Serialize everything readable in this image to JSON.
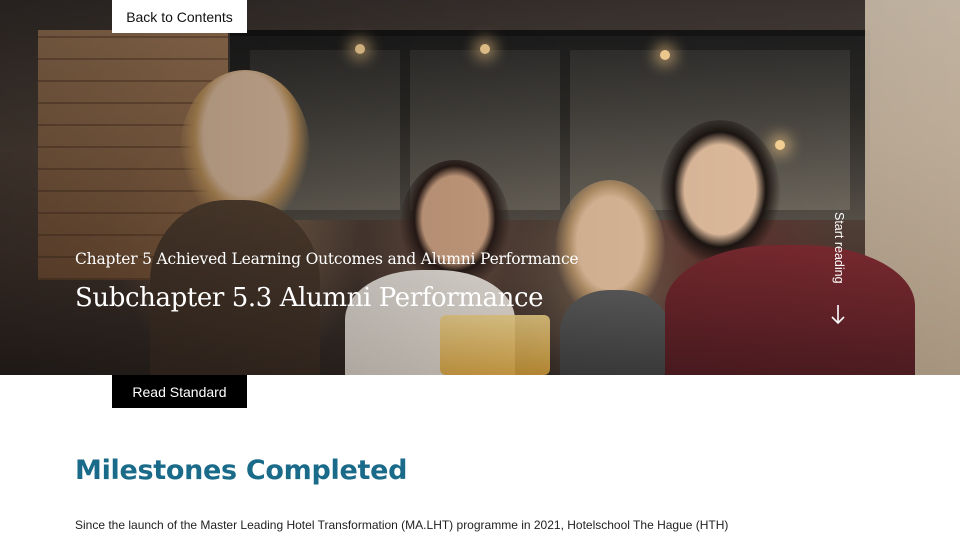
{
  "nav": {
    "back_label": "Back to Contents"
  },
  "hero": {
    "chapter": "Chapter 5 Achieved Learning Outcomes and Alumni Performance",
    "subchapter": "Subchapter 5.3 Alumni Performance",
    "start_reading": "Start reading",
    "image_alt": "Group of smiling alumni holding drinks at an indoor reception"
  },
  "actions": {
    "read_standard_label": "Read Standard"
  },
  "content": {
    "heading": "Milestones Completed",
    "paragraph": "Since the launch of the Master Leading Hotel Transformation (MA.LHT) programme in 2021, Hotelschool The Hague (HTH)"
  },
  "colors": {
    "heading": "#1a6a8a",
    "button_dark": "#000000",
    "button_light": "#ffffff"
  },
  "icons": {
    "start_reading": "arrow-down-icon"
  }
}
